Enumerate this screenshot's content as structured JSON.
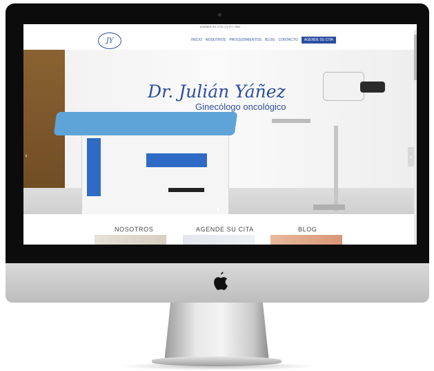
{
  "topbar": {
    "text": "AGENDE SU CITA: (7) 577-7800"
  },
  "logo": {
    "text": "JY"
  },
  "nav": {
    "items": [
      "INICIO",
      "NOSOTROS",
      "PROCEDIMIENTOS",
      "BLOG",
      "CONTACTO"
    ],
    "cta": "AGENDE SU CITA"
  },
  "hero": {
    "title": "Dr. Julián Yáñez",
    "subtitle": "Ginecólogo oncológico",
    "prev_arrow": "‹",
    "next_arrow": "›"
  },
  "sections": [
    "NOSOTROS",
    "AGENDE SU CITA",
    "BLOG"
  ],
  "colors": {
    "brand": "#2c4ea0",
    "bezel": "#0c0c0c",
    "table": "#5fa4d8",
    "drawer": "#2f6bc4"
  },
  "icons": {
    "apple": "apple-logo-icon",
    "camera": "webcam-icon"
  }
}
